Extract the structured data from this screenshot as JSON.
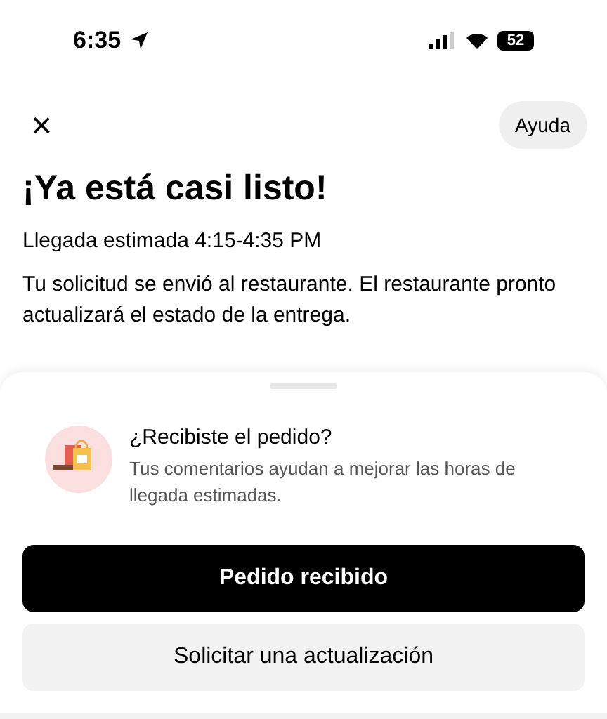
{
  "status_bar": {
    "time": "6:35",
    "battery": "52"
  },
  "header": {
    "close": "×",
    "help_button": "Ayuda"
  },
  "title": "¡Ya está casi listo!",
  "eta": "Llegada estimada 4:15-4:35 PM",
  "message": "Tu solicitud se envió al restaurante. El restaurante pronto actualizará el estado de la entrega.",
  "sheet": {
    "question": "¿Recibiste el pedido?",
    "description": "Tus comentarios ayudan a mejorar las horas de llegada estimadas.",
    "buttons": [
      {
        "label": "Pedido recibido",
        "kind": "primary"
      },
      {
        "label": "Solicitar una actualización",
        "kind": "secondary"
      }
    ]
  }
}
